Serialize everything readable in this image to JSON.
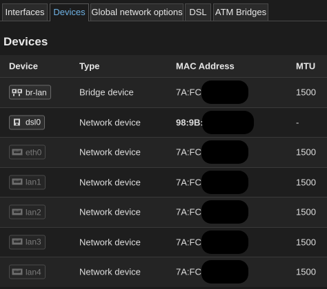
{
  "tabs": [
    {
      "label": "Interfaces",
      "active": false
    },
    {
      "label": "Devices",
      "active": true
    },
    {
      "label": "Global network options",
      "active": false
    },
    {
      "label": "DSL",
      "active": false
    },
    {
      "label": "ATM Bridges",
      "active": false
    }
  ],
  "section_title": "Devices",
  "table": {
    "headers": {
      "device": "Device",
      "type": "Type",
      "mac": "MAC Address",
      "mtu": "MTU"
    },
    "rows": [
      {
        "device": "br-lan",
        "icon": "bridge-icon",
        "type": "Bridge device",
        "mac": "7A:FC:",
        "mtu": "1500",
        "active": true
      },
      {
        "device": "dsl0",
        "icon": "dsl-port-icon",
        "type": "Network device",
        "mac": "98:9B:",
        "mtu": "-",
        "active": true
      },
      {
        "device": "eth0",
        "icon": "ethernet-port-icon",
        "type": "Network device",
        "mac": "7A:FC:",
        "mtu": "1500",
        "active": false
      },
      {
        "device": "lan1",
        "icon": "ethernet-port-icon",
        "type": "Network device",
        "mac": "7A:FC:",
        "mtu": "1500",
        "active": false
      },
      {
        "device": "lan2",
        "icon": "ethernet-port-icon",
        "type": "Network device",
        "mac": "7A:FC:",
        "mtu": "1500",
        "active": false
      },
      {
        "device": "lan3",
        "icon": "ethernet-port-icon",
        "type": "Network device",
        "mac": "7A:FC",
        "mtu": "1500",
        "active": false
      },
      {
        "device": "lan4",
        "icon": "ethernet-port-icon",
        "type": "Network device",
        "mac": "7A:FC:",
        "mtu": "1500",
        "active": false
      }
    ]
  },
  "colors": {
    "active_tab_text": "#6fb3e6",
    "background": "#1c1c1c"
  }
}
